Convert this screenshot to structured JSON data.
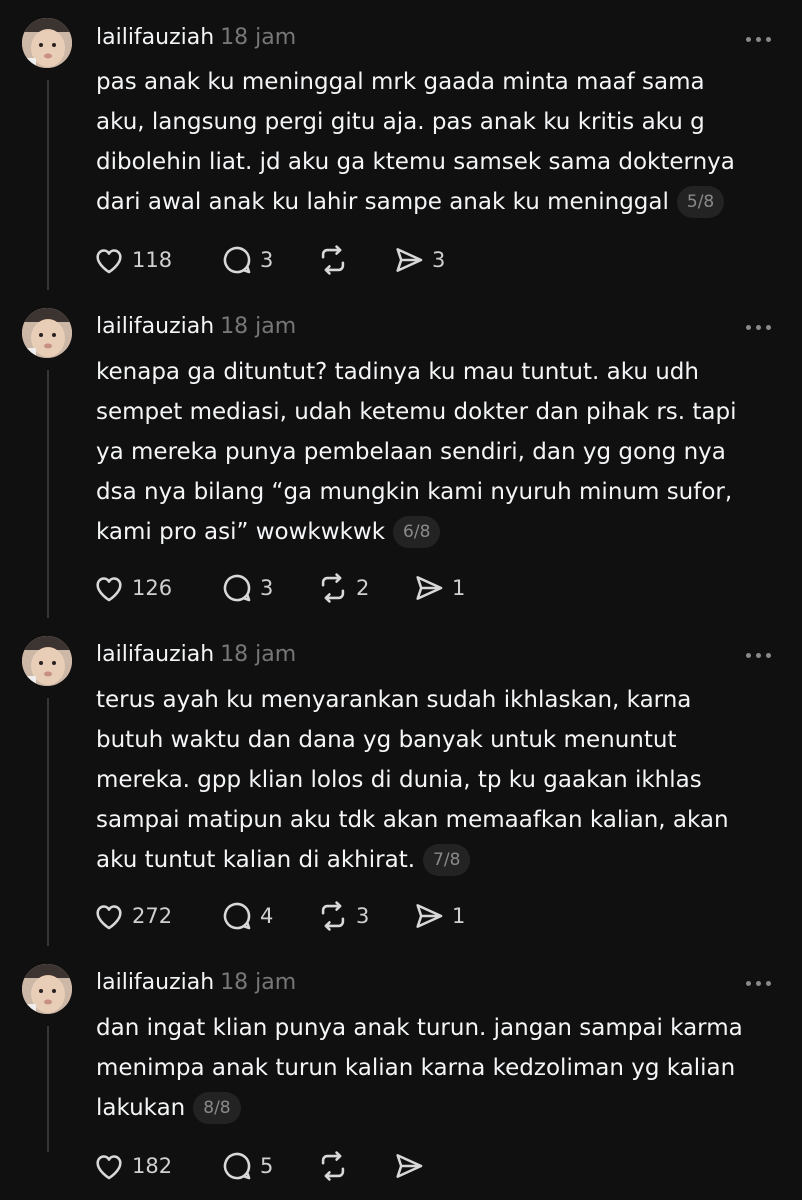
{
  "posts": [
    {
      "username": "lailifauziah",
      "time": "18 jam",
      "lines": [
        "pas anak ku meninggal mrk gaada minta maaf sama",
        "aku, langsung pergi gitu aja. pas anak ku kritis aku g",
        "dibolehin liat. jd aku ga ktemu samsek sama dokternya",
        "dari awal anak ku lahir sampe anak ku meninggal"
      ],
      "counter": "5/8",
      "likes": "118",
      "replies": "3",
      "reposts": "",
      "shares": "3"
    },
    {
      "username": "lailifauziah",
      "time": "18 jam",
      "lines": [
        "kenapa ga dituntut? tadinya ku mau tuntut. aku udh",
        "sempet mediasi, udah ketemu dokter dan pihak rs. tapi",
        "ya mereka punya pembelaan sendiri, dan yg gong nya",
        "dsa nya bilang “ga mungkin kami nyuruh minum sufor,",
        "kami pro asi” wowkwkwk"
      ],
      "counter": "6/8",
      "likes": "126",
      "replies": "3",
      "reposts": "2",
      "shares": "1"
    },
    {
      "username": "lailifauziah",
      "time": "18 jam",
      "lines": [
        "terus ayah ku menyarankan sudah ikhlaskan, karna",
        "butuh waktu dan dana yg banyak untuk menuntut",
        "mereka. gpp klian lolos di dunia, tp ku gaakan ikhlas",
        "sampai matipun aku tdk akan memaafkan kalian, akan",
        "aku tuntut kalian di akhirat."
      ],
      "counter": "7/8",
      "likes": "272",
      "replies": "4",
      "reposts": "3",
      "shares": "1"
    },
    {
      "username": "lailifauziah",
      "time": "18 jam",
      "lines": [
        "dan ingat klian punya anak turun. jangan sampai karma",
        "menimpa anak turun kalian karna kedzoliman yg kalian",
        "lakukan"
      ],
      "counter": "8/8",
      "likes": "182",
      "replies": "5",
      "reposts": "",
      "shares": ""
    }
  ],
  "icons": {
    "like": "heart-icon",
    "reply": "comment-icon",
    "repost": "repost-icon",
    "share": "send-icon",
    "more": "more-options-icon"
  },
  "colors": {
    "background": "#101010",
    "text": "#f3f5f7",
    "muted": "#777777"
  }
}
